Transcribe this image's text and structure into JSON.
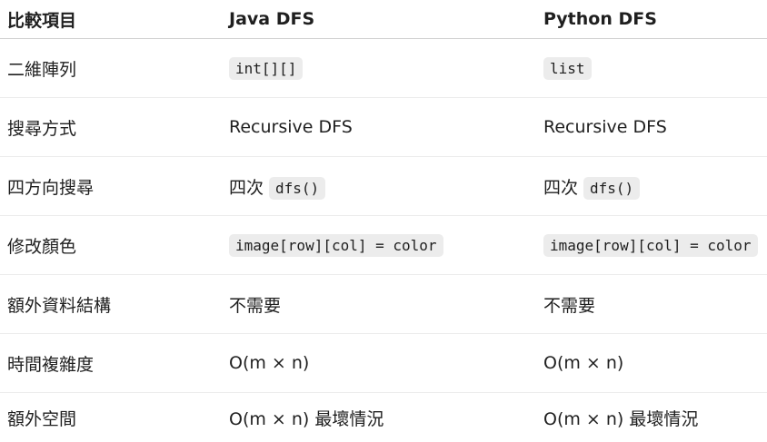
{
  "table": {
    "headers": [
      "比較項目",
      "Java DFS",
      "Python DFS"
    ],
    "rows": [
      {
        "item": "二維陣列",
        "java": {
          "prefix": "",
          "code": "int[][]"
        },
        "python": {
          "prefix": "",
          "code": "list"
        }
      },
      {
        "item": "搜尋方式",
        "java": {
          "text": "Recursive DFS"
        },
        "python": {
          "text": "Recursive DFS"
        }
      },
      {
        "item": "四方向搜尋",
        "java": {
          "prefix": "四次",
          "code": "dfs()"
        },
        "python": {
          "prefix": "四次",
          "code": "dfs()"
        }
      },
      {
        "item": "修改顏色",
        "java": {
          "prefix": "",
          "code": "image[row][col] = color"
        },
        "python": {
          "prefix": "",
          "code": "image[row][col] = color"
        }
      },
      {
        "item": "額外資料結構",
        "java": {
          "text": "不需要"
        },
        "python": {
          "text": "不需要"
        }
      },
      {
        "item": "時間複雜度",
        "java": {
          "text": "O(m × n)"
        },
        "python": {
          "text": "O(m × n)"
        }
      },
      {
        "item": "額外空間",
        "java": {
          "text": "O(m × n) 最壞情況"
        },
        "python": {
          "text": "O(m × n) 最壞情況"
        }
      }
    ]
  }
}
